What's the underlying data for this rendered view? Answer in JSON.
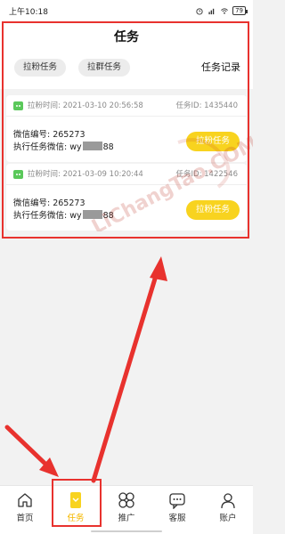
{
  "status_bar": {
    "time": "上午10:18",
    "battery": "79",
    "icons": [
      "alarm-icon",
      "signal-icon",
      "wifi-icon",
      "battery-icon"
    ]
  },
  "header": {
    "title": "任务"
  },
  "subtabs": {
    "fans_label": "拉粉任务",
    "group_label": "拉群任务",
    "record_label": "任务记录"
  },
  "tasks": [
    {
      "time": "拉粉时间: 2021-03-10 20:56:58",
      "task_id": "任务ID: 1435440",
      "wechat_no": "微信编号: 265273",
      "exec_prefix": "执行任务微信: wy",
      "exec_suffix": "88",
      "button": "拉粉任务"
    },
    {
      "time": "拉粉时间: 2021-03-09 10:20:44",
      "task_id": "任务ID: 1422546",
      "wechat_no": "微信编号: 265273",
      "exec_prefix": "执行任务微信: wy",
      "exec_suffix": "88",
      "button": "拉粉任务"
    }
  ],
  "watermark": {
    "text": "LiChangTao.COM"
  },
  "nav": {
    "items": [
      {
        "label": "首页",
        "icon": "home-icon"
      },
      {
        "label": "任务",
        "icon": "task-icon"
      },
      {
        "label": "推广",
        "icon": "promote-icon"
      },
      {
        "label": "客服",
        "icon": "service-icon"
      },
      {
        "label": "账户",
        "icon": "account-icon"
      }
    ],
    "active_index": 1
  },
  "colors": {
    "accent_yellow": "#f8d31f",
    "annotation_red": "#e8322e",
    "wechat_green": "#5ac85a"
  }
}
